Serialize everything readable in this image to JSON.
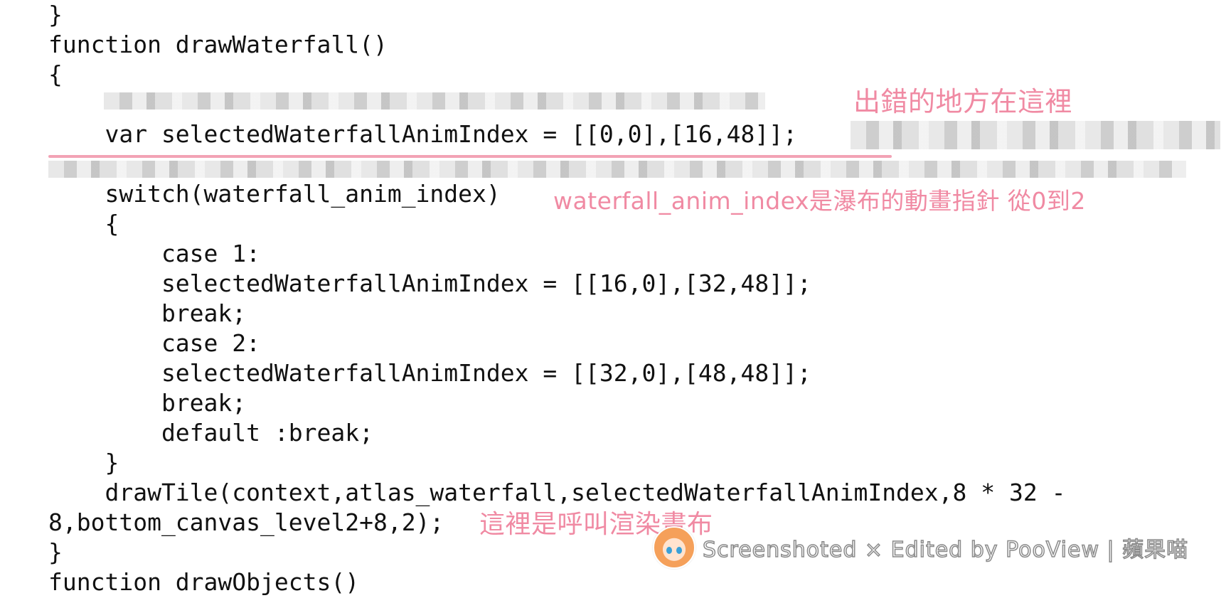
{
  "code_lines": [
    "}",
    "function drawWaterfall()",
    "{",
    "    var selectedWaterfallAnimIndex = [[0,0],[16,48]];",
    "    switch(waterfall_anim_index)",
    "    {",
    "        case 1:",
    "        selectedWaterfallAnimIndex = [[16,0],[32,48]];",
    "        break;",
    "        case 2:",
    "        selectedWaterfallAnimIndex = [[32,0],[48,48]];",
    "        break;",
    "        default :break;",
    "    }",
    "    drawTile(context,atlas_waterfall,selectedWaterfallAnimIndex,8 * 32 -",
    "8,bottom_canvas_level2+8,2);",
    "}",
    "function drawObjects()"
  ],
  "annotations": {
    "error_here": "出錯的地方在這裡",
    "index_note": "waterfall_anim_index是瀑布的動畫指針 從0到2",
    "render_call": "這裡是呼叫渲染畫布"
  },
  "watermark": {
    "text": "Screenshoted × Edited by PooView | 蘋果喵",
    "avatar_icon": "anime-girl-avatar-icon"
  },
  "colors": {
    "code_text": "#111111",
    "annotation_pink": "#f08aa3",
    "background": "#ffffff"
  }
}
